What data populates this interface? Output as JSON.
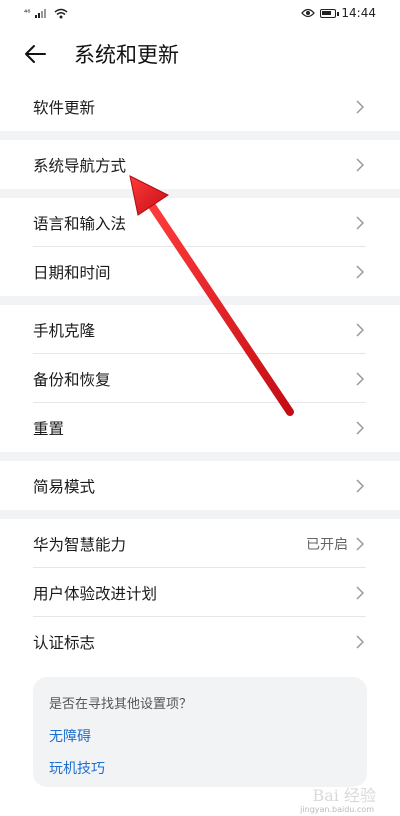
{
  "status_bar": {
    "signal_left": "⁴⁶",
    "time": "14:44"
  },
  "header": {
    "title": "系统和更新"
  },
  "groups": [
    {
      "items": [
        {
          "label": "软件更新"
        }
      ]
    },
    {
      "items": [
        {
          "label": "系统导航方式"
        }
      ]
    },
    {
      "items": [
        {
          "label": "语言和输入法"
        },
        {
          "label": "日期和时间"
        }
      ]
    },
    {
      "items": [
        {
          "label": "手机克隆"
        },
        {
          "label": "备份和恢复"
        },
        {
          "label": "重置"
        }
      ]
    },
    {
      "items": [
        {
          "label": "简易模式"
        }
      ]
    },
    {
      "items": [
        {
          "label": "华为智慧能力",
          "value": "已开启"
        },
        {
          "label": "用户体验改进计划"
        },
        {
          "label": "认证标志"
        }
      ]
    }
  ],
  "suggest": {
    "title": "是否在寻找其他设置项？",
    "links": [
      "无障碍",
      "玩机技巧"
    ]
  },
  "watermark": {
    "text": "Bai 经验",
    "url": "jingyan.baidu.com"
  },
  "colors": {
    "link": "#1f6fd1",
    "arrow": "#e0141e",
    "divider_band": "#f1f3f5"
  }
}
